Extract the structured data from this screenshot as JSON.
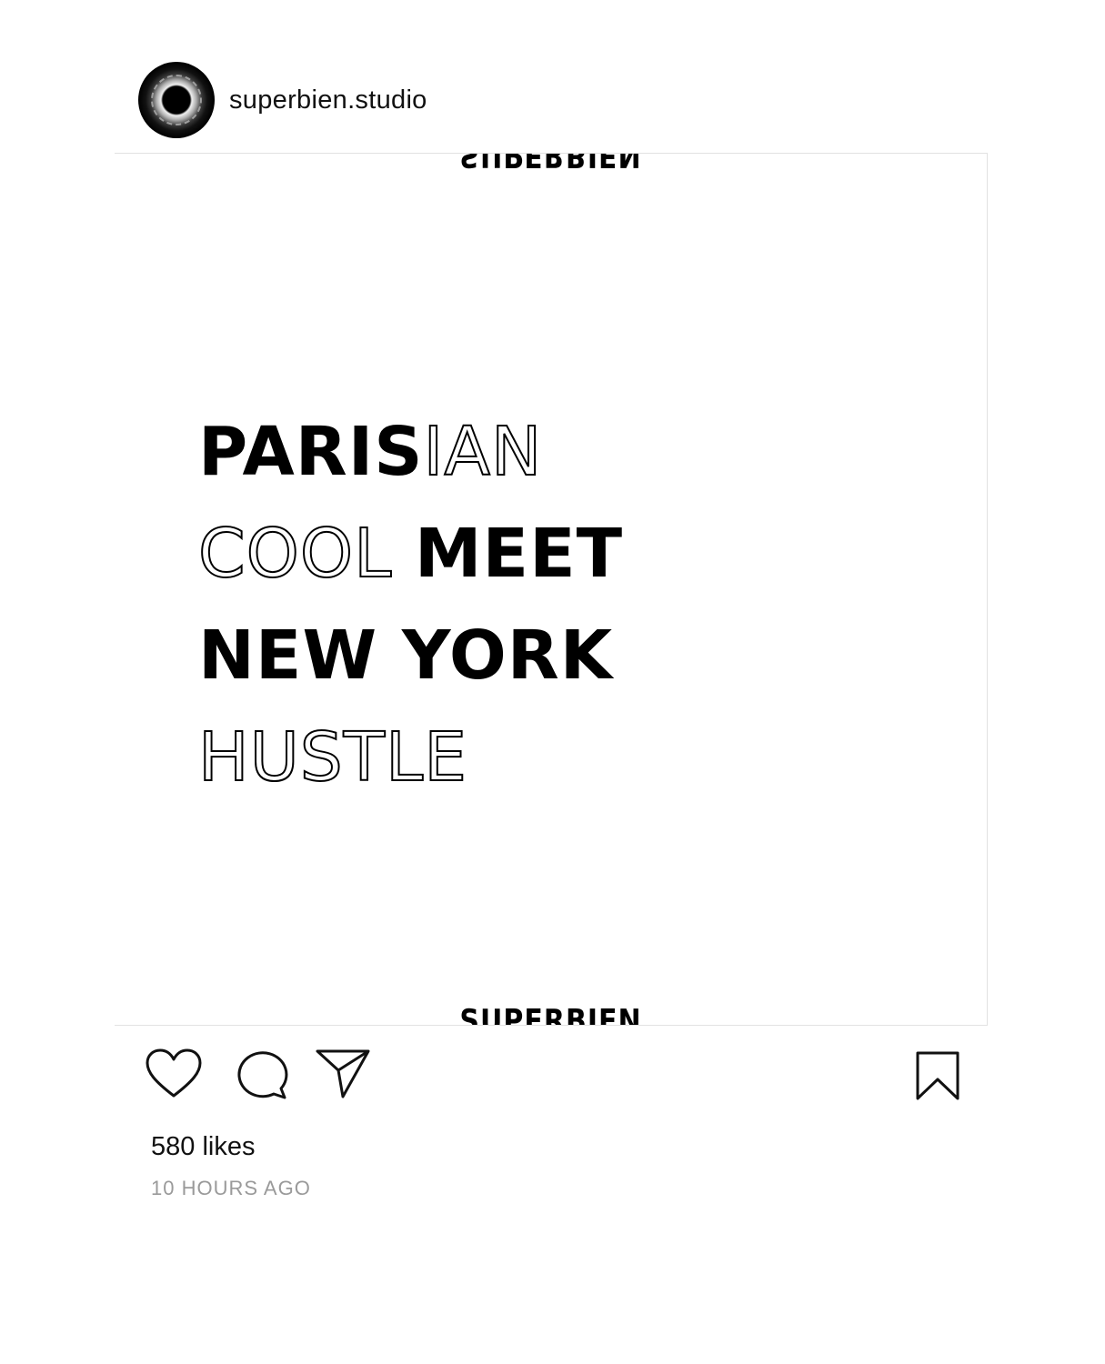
{
  "header": {
    "username": "superbien.studio"
  },
  "post": {
    "logo_text": "SUPERBIEN",
    "headline": [
      [
        {
          "text": "PARIS",
          "style": "solid"
        },
        {
          "text": "IAN",
          "style": "outline"
        }
      ],
      [
        {
          "text": "COOL ",
          "style": "outline"
        },
        {
          "text": "MEET",
          "style": "solid"
        }
      ],
      [
        {
          "text": "NEW YORK",
          "style": "solid"
        }
      ],
      [
        {
          "text": "HUSTLE",
          "style": "outline"
        }
      ]
    ]
  },
  "actions": {
    "icons": [
      "heart-icon",
      "comment-icon",
      "share-icon",
      "bookmark-icon"
    ]
  },
  "stats": {
    "likes": "580 likes",
    "time": "10 HOURS AGO"
  },
  "colors": {
    "text": "#111111",
    "muted": "#9a9a9a",
    "border": "#e2e2e2"
  }
}
